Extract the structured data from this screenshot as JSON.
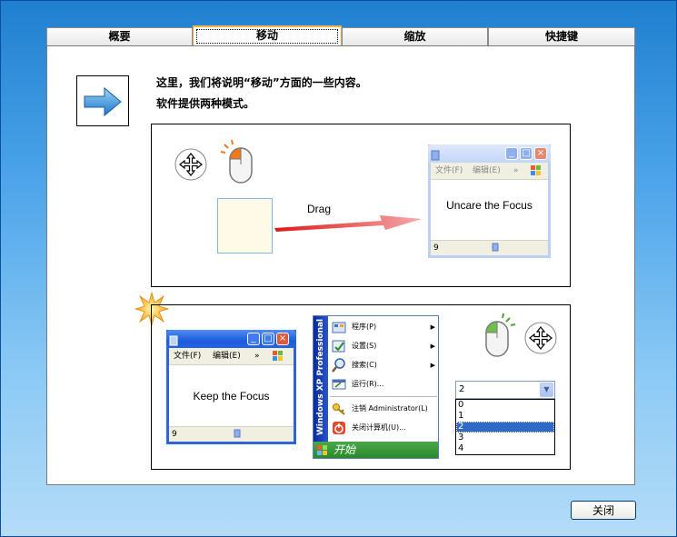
{
  "tabs": [
    "概要",
    "移动",
    "缩放",
    "快捷键"
  ],
  "active_tab": "移动",
  "description": {
    "line1": "这里，我们将说明“移动”方面的一些内容。",
    "line2": "软件提供两种模式。"
  },
  "mode1": {
    "drag_label": "Drag",
    "window": {
      "menu": [
        "文件(F)",
        "编辑(E)"
      ],
      "body_text": "Uncare the Focus",
      "status": "9"
    }
  },
  "mode2": {
    "window": {
      "menu": [
        "文件(F)",
        "编辑(E)"
      ],
      "body_text": "Keep the Focus",
      "status": "9"
    },
    "start_menu": {
      "strip_text": "Windows XP Professional",
      "items": [
        {
          "label": "程序(P)",
          "submenu": true
        },
        {
          "label": "设置(S)",
          "submenu": true
        },
        {
          "label": "搜索(C)",
          "submenu": true
        },
        {
          "label": "运行(R)...",
          "submenu": false
        },
        {
          "label": "注销 Administrator(L)",
          "submenu": false
        },
        {
          "label": "关闭计算机(U)...",
          "submenu": false
        }
      ],
      "start_button": "开始"
    },
    "combo": {
      "value": "2",
      "options": [
        "0",
        "1",
        "2",
        "3",
        "4"
      ],
      "selected_index": 2
    }
  },
  "footer": {
    "close_label": "关闭"
  },
  "colors": {
    "accent_blue": "#2e63d9",
    "tab_active_border": "#f2b34a",
    "drag_arrow": "#e01818"
  }
}
